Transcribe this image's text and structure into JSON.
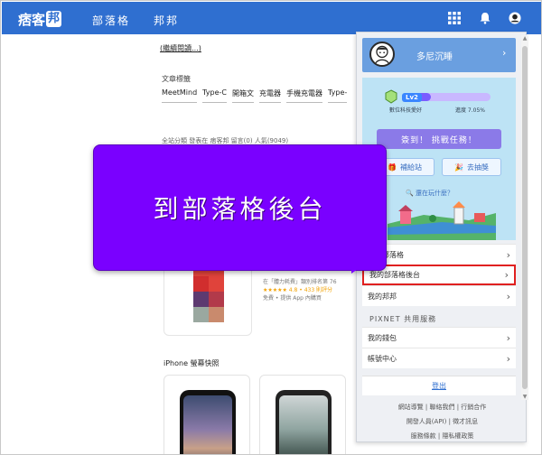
{
  "brand": {
    "logo_text": "痞客",
    "logo_badge": "邦"
  },
  "topnav": {
    "links": [
      "部落格",
      "邦邦"
    ],
    "icons": [
      "grid-icon",
      "bell-icon",
      "account-icon"
    ],
    "bar_color": "#2f6fd0"
  },
  "article": {
    "read_more": "(繼續閱讀...)",
    "tags_title": "文章標籤",
    "tags": [
      "MeetMind",
      "Type-C",
      "開箱文",
      "充電器",
      "手機充電器",
      "Type-"
    ],
    "byline": "全站分類 發表在 痞客邦 留言(0) 人氣(9049)",
    "app_meta": {
      "line1": "在「體力耗費」類別排名第 76",
      "rating": "★★★★★ 4.8 • 433 則評分",
      "line3": "免費 • 提供 App 內購買"
    },
    "iphone_title": "iPhone 螢幕快照"
  },
  "banner": {
    "text": "到部落格後台",
    "color": "#7a00ff"
  },
  "panel": {
    "user": {
      "name": "多尼沉睡"
    },
    "level": {
      "badge": "Lv2",
      "caption": "數位科技愛好",
      "progress_label": "進度 7.05%",
      "progress": 0.0705
    },
    "mission_button": "簽到！ 挑戰任務！",
    "buttons": [
      {
        "label": "補給站",
        "icon": "gift-icon"
      },
      {
        "label": "去抽獎",
        "icon": "party-icon"
      }
    ],
    "playing": "還在玩什麼？",
    "menu_blog": [
      {
        "label": "我的部落格"
      },
      {
        "label": "我的部落格後台"
      },
      {
        "label": "我的邦邦"
      }
    ],
    "pixnet_title": "PIXNET 共用服務",
    "menu_pixnet": [
      {
        "label": "我的錢包"
      },
      {
        "label": "帳號中心"
      }
    ],
    "logout": "登出",
    "footer": [
      "網站導覽 | 聯絡我們 | 行銷合作",
      "開發人員(API) | 徵才訊息",
      "服務條款 | 隱私權政策"
    ]
  }
}
